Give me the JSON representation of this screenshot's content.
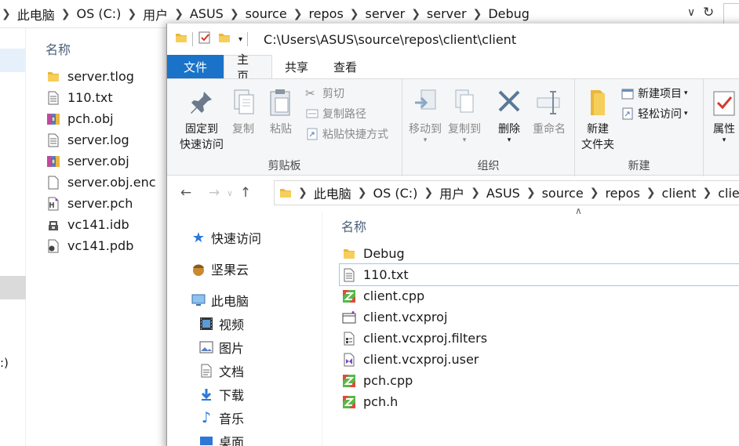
{
  "background_window": {
    "breadcrumb": [
      "此电脑",
      "OS (C:)",
      "用户",
      "ASUS",
      "source",
      "repos",
      "server",
      "server",
      "Debug"
    ],
    "nav_fragment": ":)",
    "column_header": "名称",
    "files": [
      {
        "name": "server.tlog",
        "icon": "folder-icon"
      },
      {
        "name": "110.txt",
        "icon": "text-file-icon"
      },
      {
        "name": "pch.obj",
        "icon": "archive-icon"
      },
      {
        "name": "server.log",
        "icon": "text-file-icon"
      },
      {
        "name": "server.obj",
        "icon": "archive-icon"
      },
      {
        "name": "server.obj.enc",
        "icon": "blank-file-icon"
      },
      {
        "name": "server.pch",
        "icon": "pch-file-icon"
      },
      {
        "name": "vc141.idb",
        "icon": "idb-file-icon"
      },
      {
        "name": "vc141.pdb",
        "icon": "pdb-file-icon"
      }
    ]
  },
  "foreground_window": {
    "title_path": "C:\\Users\\ASUS\\source\\repos\\client\\client",
    "ribbon_tabs": {
      "file": "文件",
      "home": "主页",
      "share": "共享",
      "view": "查看"
    },
    "clipboard": {
      "group_label": "剪贴板",
      "pin_line1": "固定到",
      "pin_line2": "快速访问",
      "copy": "复制",
      "paste": "粘贴",
      "cut": "剪切",
      "copy_path": "复制路径",
      "paste_shortcut": "粘贴快捷方式"
    },
    "organize": {
      "group_label": "组织",
      "move_to": "移动到",
      "copy_to": "复制到",
      "delete": "删除",
      "rename": "重命名"
    },
    "new_group": {
      "group_label": "新建",
      "new_folder_line1": "新建",
      "new_folder_line2": "文件夹",
      "new_item": "新建项目",
      "easy_access": "轻松访问"
    },
    "open_group": {
      "properties": "属性"
    },
    "address": [
      "此电脑",
      "OS (C:)",
      "用户",
      "ASUS",
      "source",
      "repos",
      "client",
      "client"
    ],
    "column_header": "名称",
    "tree": {
      "quick_access": "快速访问",
      "jianguoyun": "坚果云",
      "this_pc": "此电脑",
      "videos": "视频",
      "pictures": "图片",
      "documents": "文档",
      "downloads": "下载",
      "music": "音乐",
      "desktop": "桌面"
    },
    "files": [
      {
        "name": "Debug",
        "icon": "folder-icon"
      },
      {
        "name": "110.txt",
        "icon": "text-file-icon"
      },
      {
        "name": "client.cpp",
        "icon": "cpp-file-icon"
      },
      {
        "name": "client.vcxproj",
        "icon": "vcxproj-icon"
      },
      {
        "name": "client.vcxproj.filters",
        "icon": "filters-file-icon"
      },
      {
        "name": "client.vcxproj.user",
        "icon": "vs-user-file-icon"
      },
      {
        "name": "pch.cpp",
        "icon": "cpp-file-icon"
      },
      {
        "name": "pch.h",
        "icon": "cpp-file-icon"
      }
    ]
  },
  "colors": {
    "file_tab": "#1a73c9",
    "folder": "#e8b73e",
    "header_text": "#4c607a",
    "selection_outline": "#99c8f0",
    "ribbon_bg": "#f5f6f7"
  }
}
